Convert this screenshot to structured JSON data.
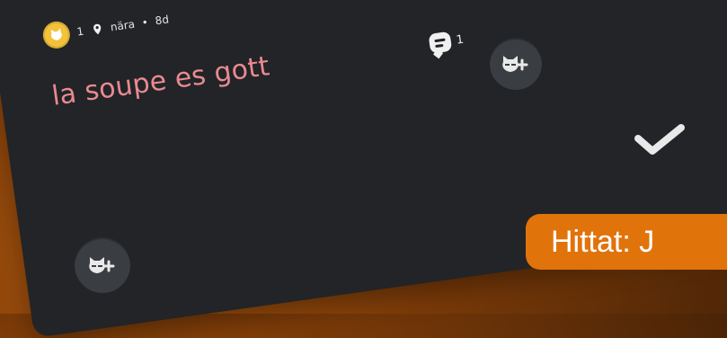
{
  "post": {
    "avatar_count": "1",
    "location": "nära",
    "time": "8d",
    "message": "la soupe es gott",
    "comment_count": "1"
  },
  "badge": {
    "found_text": "Hittat: J"
  },
  "icons": {
    "avatar_icon": "cat-face",
    "location_icon": "map-pin",
    "comment_icon": "speech-bubble",
    "add_reaction_icon": "cat-mask-plus",
    "check_icon": "checkmark"
  },
  "colors": {
    "card": "#222427",
    "message": "#e88a92",
    "badge": "#e1730b",
    "pointer_stroke": "#9aa1dc"
  }
}
